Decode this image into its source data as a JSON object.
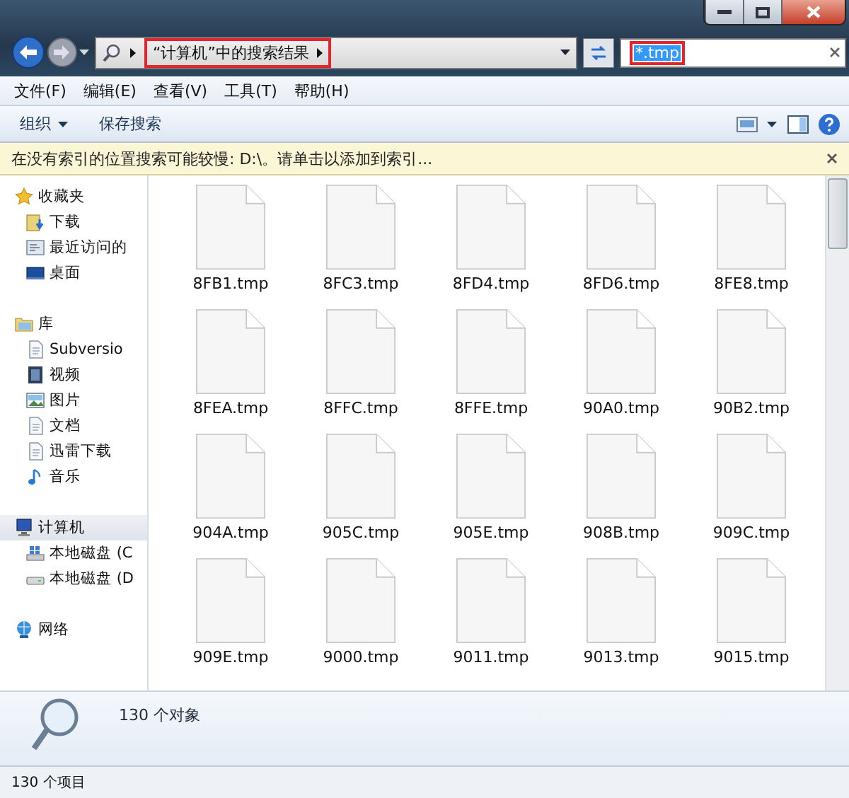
{
  "address": {
    "breadcrumb": "“计算机”中的搜索结果",
    "annotated": true
  },
  "search": {
    "value": "*.tmp",
    "highlighted": true,
    "annotated": true
  },
  "menu": [
    "文件(F)",
    "编辑(E)",
    "查看(V)",
    "工具(T)",
    "帮助(H)"
  ],
  "toolbar": {
    "buttons": [
      {
        "label": "组织",
        "dropdown": true
      },
      {
        "label": "保存搜索",
        "dropdown": false
      }
    ]
  },
  "info_bar": {
    "text": "在没有索引的位置搜索可能较慢: D:\\。请单击以添加到索引..."
  },
  "sidebar": {
    "groups": [
      {
        "label": "收藏夹",
        "kind": "star",
        "selected": false,
        "children": [
          {
            "label": "下载",
            "kind": "download",
            "selected": false
          },
          {
            "label": "最近访问的",
            "kind": "recent",
            "selected": false
          },
          {
            "label": "桌面",
            "kind": "desktop",
            "selected": false
          }
        ]
      },
      {
        "label": "库",
        "kind": "library",
        "selected": false,
        "children": [
          {
            "label": "Subversio",
            "kind": "document",
            "selected": false
          },
          {
            "label": "视频",
            "kind": "video",
            "selected": false
          },
          {
            "label": "图片",
            "kind": "picture",
            "selected": false
          },
          {
            "label": "文档",
            "kind": "document",
            "selected": false
          },
          {
            "label": "迅雷下载",
            "kind": "document",
            "selected": false
          },
          {
            "label": "音乐",
            "kind": "music",
            "selected": false
          }
        ]
      },
      {
        "label": "计算机",
        "kind": "computer",
        "selected": true,
        "children": [
          {
            "label": "本地磁盘 (C",
            "kind": "system-drive",
            "selected": false
          },
          {
            "label": "本地磁盘 (D",
            "kind": "drive",
            "selected": false
          }
        ]
      },
      {
        "label": "网络",
        "kind": "network",
        "selected": false
      }
    ]
  },
  "files": [
    "8FB1.tmp",
    "8FC3.tmp",
    "8FD4.tmp",
    "8FD6.tmp",
    "8FE8.tmp",
    "8FEA.tmp",
    "8FFC.tmp",
    "8FFE.tmp",
    "90A0.tmp",
    "90B2.tmp",
    "904A.tmp",
    "905C.tmp",
    "905E.tmp",
    "908B.tmp",
    "909C.tmp",
    "909E.tmp",
    "9000.tmp",
    "9011.tmp",
    "9013.tmp",
    "9015.tmp"
  ],
  "details": {
    "count": "130 个对象"
  },
  "status_bar": {
    "text": "130 个项目"
  }
}
